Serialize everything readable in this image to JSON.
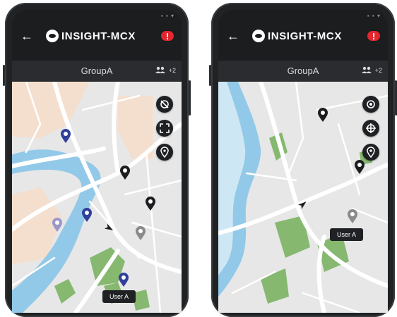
{
  "app": {
    "title": "INSIGHT-MCX"
  },
  "screens": [
    {
      "group_title": "GroupA",
      "members_extra": "+2",
      "user_label": "User A"
    },
    {
      "group_title": "GroupA",
      "members_extra": "+2",
      "user_label": "User A"
    }
  ],
  "icons": {
    "back": "back-arrow-icon",
    "logo": "insight-logo-icon",
    "alert": "emergency-alert-icon",
    "members": "group-members-icon",
    "left_controls": [
      "location-off-icon",
      "fullscreen-icon",
      "pin-icon"
    ],
    "right_controls": [
      "my-location-icon",
      "crosshair-icon",
      "pin-plus-icon"
    ]
  },
  "colors": {
    "app_bg": "#1b1d1f",
    "bar": "#2a2c2f",
    "alert_red": "#e3262f",
    "pin_blue": "#2f3f9a",
    "pin_lavender": "#9b98c8",
    "pin_black": "#1b1d1f",
    "pin_gray": "#8a8a8a",
    "map_bg": "#e7e7e7",
    "river": "#93c9e8",
    "park": "#86b86f"
  }
}
